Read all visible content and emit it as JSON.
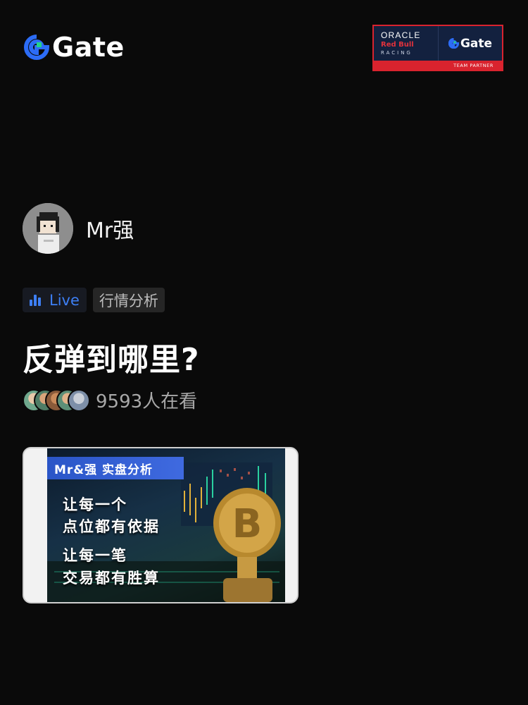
{
  "header": {
    "logo_text": "Gate",
    "partner": {
      "oracle": "ORACLE",
      "redbull": "Red Bull",
      "racing": "RACING",
      "gate_text": "Gate",
      "team_partner": "TEAM PARTNER"
    }
  },
  "host": {
    "name": "Mr强",
    "avatar_icon": "pixel-character-avatar"
  },
  "tags": {
    "live_label": "Live",
    "category": "行情分析"
  },
  "stream": {
    "title": "反弹到哪里?",
    "viewer_count_text": "9593人在看"
  },
  "cover": {
    "header": "Mr&强 实盘分析",
    "lines": [
      "让每一个",
      "点位都有依据",
      "让每一笔",
      "交易都有胜算"
    ]
  },
  "colors": {
    "accent": "#3d7ff5",
    "brand_partner_red": "#d9232e",
    "background": "#0a0a0a"
  }
}
